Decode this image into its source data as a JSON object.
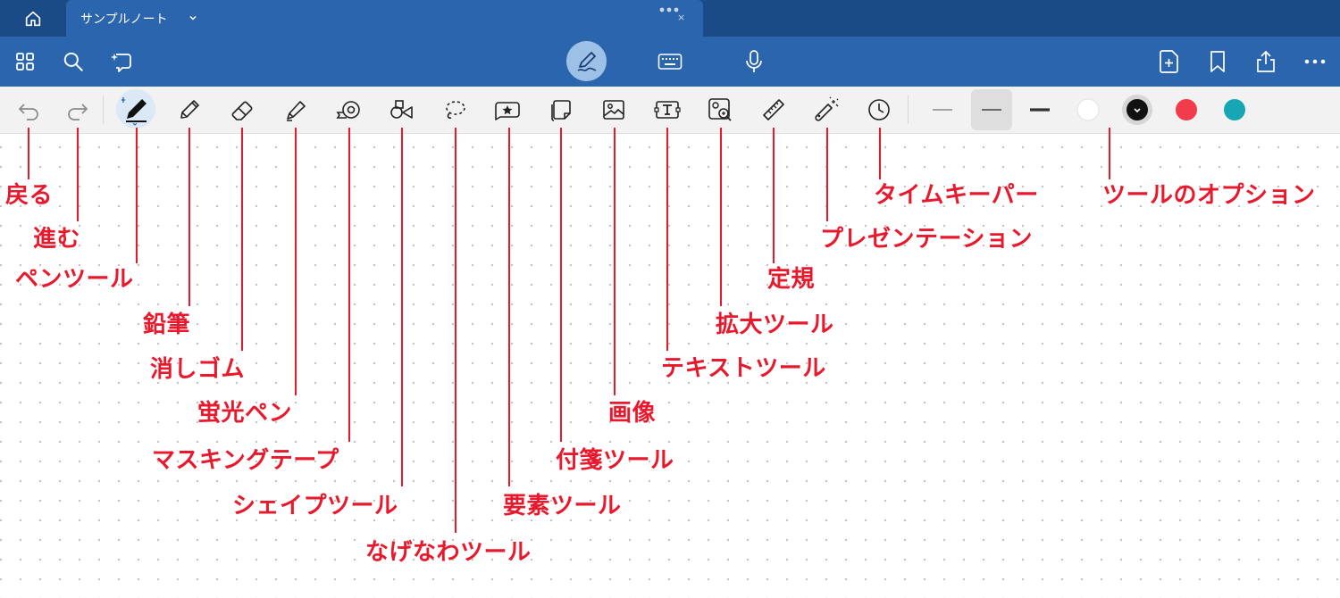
{
  "titlebar": {
    "tab_title": "サンプルノート",
    "close_glyph": "×",
    "colors": {
      "titlebar_bg": "#1a4b87",
      "tab_bg": "#2a65ad"
    }
  },
  "icons": {
    "home": "home-icon",
    "grid": "grid-icon",
    "search": "search-icon",
    "lasso_ai": "lasso-sparkle-icon",
    "pen_mode": "pen-mode-icon",
    "keyboard": "keyboard-icon",
    "mic": "microphone-icon",
    "add_page": "add-page-icon",
    "bookmark": "bookmark-icon",
    "share": "share-icon",
    "more": "more-icon"
  },
  "toolbar": {
    "stroke_widths": [
      "thin",
      "medium",
      "thick"
    ],
    "colors": [
      "#ffffff",
      "#111111",
      "#f23b4b",
      "#16a6b4"
    ],
    "selected_color": "#111111"
  },
  "annotations": {
    "color": "#e8192c",
    "undo": "戻る",
    "redo": "進む",
    "pen": "ペンツール",
    "pencil": "鉛筆",
    "eraser": "消しゴム",
    "highlighter": "蛍光ペン",
    "masking_tape": "マスキングテープ",
    "shape": "シェイプツール",
    "lasso": "なげなわツール",
    "elements": "要素ツール",
    "sticky": "付箋ツール",
    "image": "画像",
    "text": "テキストツール",
    "zoom": "拡大ツール",
    "ruler": "定規",
    "presentation": "プレゼンテーション",
    "timer": "タイムキーパー",
    "tool_options": "ツールのオプション"
  }
}
